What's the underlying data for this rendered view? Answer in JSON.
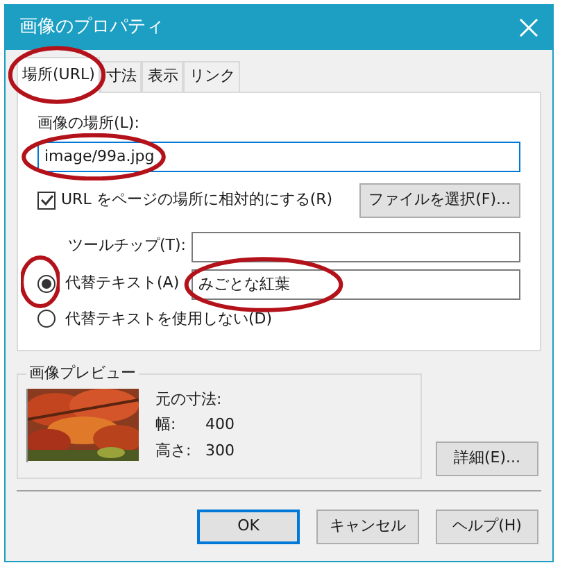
{
  "window": {
    "title": "画像のプロパティ"
  },
  "tabs": [
    {
      "label": "場所(URL)",
      "selected": true,
      "circled": true
    },
    {
      "label": "寸法",
      "selected": false,
      "circled": false
    },
    {
      "label": "表示",
      "selected": false,
      "circled": false
    },
    {
      "label": "リンク",
      "selected": false,
      "circled": false
    }
  ],
  "location": {
    "label": "画像の場所(L):",
    "value": "image/99a.jpg",
    "circled": true
  },
  "relative_checkbox": {
    "label": "URL をページの場所に相対的にする(R)",
    "checked": true
  },
  "choose_file_button": "ファイルを選択(F)...",
  "tooltip": {
    "label": "ツールチップ(T):"
  },
  "alt_options": [
    {
      "label": "代替テキスト(A)",
      "selected": true,
      "circled": true,
      "value": "みごとな紅葉",
      "value_circled": true
    },
    {
      "label": "代替テキストを使用しない(D)",
      "selected": false,
      "circled": false
    }
  ],
  "preview": {
    "title": "画像プレビュー",
    "caption": "元の寸法:",
    "rows": [
      {
        "label": "幅:",
        "value": "400"
      },
      {
        "label": "高さ:",
        "value": "300"
      }
    ]
  },
  "details_button": "詳細(E)...",
  "buttons": [
    {
      "label": "OK",
      "default": true
    },
    {
      "label": "キャンセル",
      "default": false
    },
    {
      "label": "ヘルプ(H)",
      "default": false
    }
  ]
}
